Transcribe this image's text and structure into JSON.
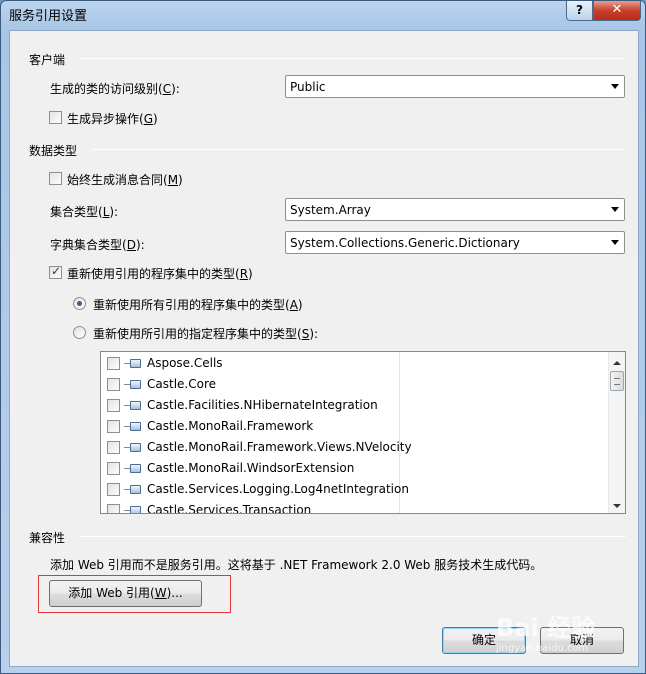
{
  "window": {
    "title": "服务引用设置",
    "help_glyph": "?",
    "close_glyph": "✕"
  },
  "client_section": {
    "header": "客户端",
    "access_label_pre": "生成的类的访问级别(",
    "access_label_key": "C",
    "access_label_post": "):",
    "access_value": "Public",
    "async_label_pre": "生成异步操作(",
    "async_label_key": "G",
    "async_label_post": ")",
    "async_checked": false
  },
  "data_section": {
    "header": "数据类型",
    "always_msg_pre": "始终生成消息合同(",
    "always_msg_key": "M",
    "always_msg_post": ")",
    "always_msg_checked": false,
    "collection_label_pre": "集合类型(",
    "collection_label_key": "L",
    "collection_label_post": "):",
    "collection_value": "System.Array",
    "dict_label_pre": "字典集合类型(",
    "dict_label_key": "D",
    "dict_label_post": "):",
    "dict_value": "System.Collections.Generic.Dictionary",
    "reuse_label_pre": "重新使用引用的程序集中的类型(",
    "reuse_label_key": "R",
    "reuse_label_post": ")",
    "reuse_checked": true,
    "reuse_all_pre": "重新使用所有引用的程序集中的类型(",
    "reuse_all_key": "A",
    "reuse_all_post": ")",
    "reuse_all_selected": true,
    "reuse_specified_pre": "重新使用所引用的指定程序集中的类型(",
    "reuse_specified_key": "S",
    "reuse_specified_post": "):",
    "reuse_specified_selected": false,
    "assemblies": [
      "Aspose.Cells",
      "Castle.Core",
      "Castle.Facilities.NHibernateIntegration",
      "Castle.MonoRail.Framework",
      "Castle.MonoRail.Framework.Views.NVelocity",
      "Castle.MonoRail.WindsorExtension",
      "Castle.Services.Logging.Log4netIntegration",
      "Castle.Services.Transaction"
    ]
  },
  "compat_section": {
    "header": "兼容性",
    "description": "添加 Web 引用而不是服务引用。这将基于 .NET Framework 2.0 Web 服务技术生成代码。",
    "add_web_ref_pre": "添加 Web 引用(",
    "add_web_ref_key": "W",
    "add_web_ref_post": ")..."
  },
  "footer": {
    "ok_label": "确定",
    "cancel_label": "取消"
  },
  "watermark": {
    "text": "Bai 经验",
    "sub": "jingyan.baidu.com"
  },
  "colors": {
    "highlight": "#e5343a",
    "title_bar": "#a9c6e6"
  }
}
